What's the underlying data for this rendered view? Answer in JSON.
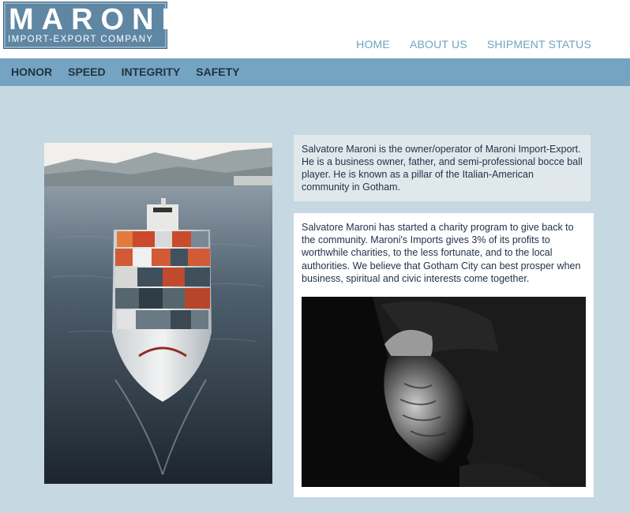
{
  "logo": {
    "name": "MARONI",
    "tagline": "IMPORT-EXPORT COMPANY"
  },
  "top_nav": [
    {
      "label": "HOME"
    },
    {
      "label": "ABOUT US"
    },
    {
      "label": "SHIPMENT STATUS"
    }
  ],
  "sub_nav": [
    {
      "label": "HONOR"
    },
    {
      "label": "SPEED"
    },
    {
      "label": "INTEGRITY"
    },
    {
      "label": "SAFETY"
    }
  ],
  "content": {
    "intro_text": "Salvatore Maroni is the owner/operator of Maroni Import-Export. He is a business owner, father, and semi-professional bocce ball player. He is known as a pillar of the Italian-American community in Gotham.",
    "charity_text": "Salvatore Maroni has started a charity program to give back to the community. Maroni's Imports gives 3% of its profits to worthwhile charities, to the less fortunate, and to the local authorities. We believe that Gotham City can best prosper when business, spiritual and civic interests come together."
  },
  "colors": {
    "page_bg": "#c6d8e1",
    "nav_bar": "#75a3c2",
    "top_link": "#6fa4c0",
    "logo_bg": "#5f86a3"
  }
}
